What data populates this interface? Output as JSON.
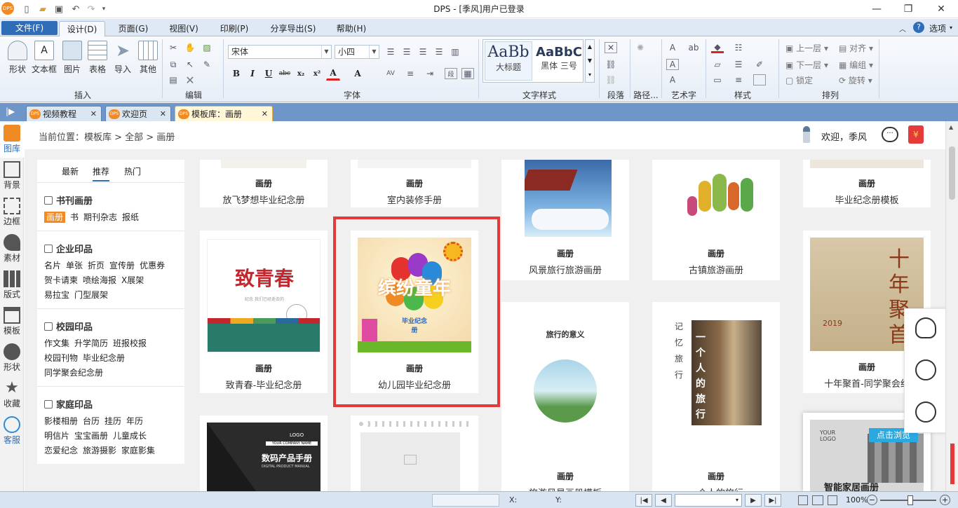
{
  "app": {
    "title": "DPS - [季风]用户已登录",
    "logo": "DPS"
  },
  "menu": {
    "file": "文件(F)",
    "design": "设计(D)",
    "page": "页面(G)",
    "view": "视图(V)",
    "print": "印刷(P)",
    "share": "分享导出(S)",
    "help": "帮助(H)",
    "options": "选项"
  },
  "ribbon": {
    "insert": {
      "label": "插入",
      "shape": "形状",
      "textbox": "文本框",
      "image": "图片",
      "table": "表格",
      "import": "导入",
      "other": "其他"
    },
    "edit": {
      "label": "编辑"
    },
    "font": {
      "label": "字体",
      "family": "宋体",
      "size": "小四"
    },
    "textstyle": {
      "label": "文字样式",
      "sample1": "AaBb",
      "sample1_name": "大标题",
      "sample2": "AaBbC",
      "sample2_name": "黑体 三号"
    },
    "paragraph": {
      "label": "段落"
    },
    "path": {
      "label": "路径..."
    },
    "arttext": {
      "label": "艺术字"
    },
    "style": {
      "label": "样式"
    },
    "arrange": {
      "label": "排列",
      "up": "上一层",
      "align": "对齐",
      "down": "下一层",
      "group": "编组",
      "lock": "锁定",
      "rotate": "旋转"
    }
  },
  "tabs": [
    {
      "label": "视频教程"
    },
    {
      "label": "欢迎页"
    },
    {
      "label": "模板库：画册"
    }
  ],
  "sidebar": [
    {
      "label": "图库"
    },
    {
      "label": "背景"
    },
    {
      "label": "边框"
    },
    {
      "label": "素材"
    },
    {
      "label": "版式"
    },
    {
      "label": "模板"
    },
    {
      "label": "形状"
    },
    {
      "label": "收藏"
    },
    {
      "label": "客服"
    }
  ],
  "breadcrumb": "当前位置：模板库 > 全部 > 画册",
  "user": {
    "welcome": "欢迎，季风"
  },
  "categories": {
    "tabs": {
      "recent": "最新",
      "recommend": "推荐",
      "hot": "热门"
    },
    "book": {
      "title": "书刊画册",
      "items": [
        "画册",
        "书",
        "期刊杂志",
        "报纸"
      ]
    },
    "enterprise": {
      "title": "企业印品",
      "line1": [
        "名片",
        "单张",
        "折页",
        "宣传册",
        "优惠券"
      ],
      "line2": [
        "贺卡请柬",
        "喷绘海报",
        "X展架"
      ],
      "line3": [
        "易拉宝",
        "门型展架"
      ]
    },
    "campus": {
      "title": "校园印品",
      "line1": [
        "作文集",
        "升学简历",
        "班报校报"
      ],
      "line2": [
        "校园刊物",
        "毕业纪念册"
      ],
      "line3": [
        "同学聚会纪念册"
      ]
    },
    "family": {
      "title": "家庭印品",
      "line1": [
        "影楼相册",
        "台历",
        "挂历",
        "年历"
      ],
      "line2": [
        "明信片",
        "宝宝画册",
        "儿童成长"
      ],
      "line3": [
        "恋爱纪念",
        "旅游摄影",
        "家庭影集"
      ]
    }
  },
  "templates": {
    "kind": "画册",
    "t1": "放飞梦想毕业纪念册",
    "t2": "室内装修手册",
    "t3": "风景旅行旅游画册",
    "t4": "古镇旅游画册",
    "t5": "毕业纪念册模板",
    "t6": "致青春-毕业纪念册",
    "t7": "幼儿园毕业纪念册",
    "t8": "旅游风景画册模板",
    "t9": "一个人的旅行",
    "t10": "十年聚首-同学聚会纪",
    "t11": "数码产品手册",
    "t13": "智能家居画册"
  },
  "thumbs": {
    "t6_title": "致青春",
    "t6_sub": "纪念 我们已经逝去的",
    "t7_title": "缤纷童年",
    "t7_sub": "毕业纪念册",
    "t8_title": "旅行的意义",
    "t9_side": "记忆旅行",
    "t9_main": "一个人的旅行",
    "t10_title": "十年聚首",
    "t10_year": "2019",
    "t11_logo": "LOGO",
    "t11_company": "YOUR COMPANY NAME",
    "t11_title": "数码产品手册",
    "t11_sub": "DIGITAL PRODUCT MANUAL",
    "t13_logo": "YOUR LOGO",
    "t13_title": "智能家居画册",
    "browse": "点击浏览"
  },
  "status": {
    "x": "X:",
    "y": "Y:",
    "zoom": "100%"
  },
  "colors": {
    "menu_active": "#2f6db8",
    "tabbar": "#6e96c8",
    "selection": "#e53a3a",
    "accent_orange": "#f08a24"
  }
}
